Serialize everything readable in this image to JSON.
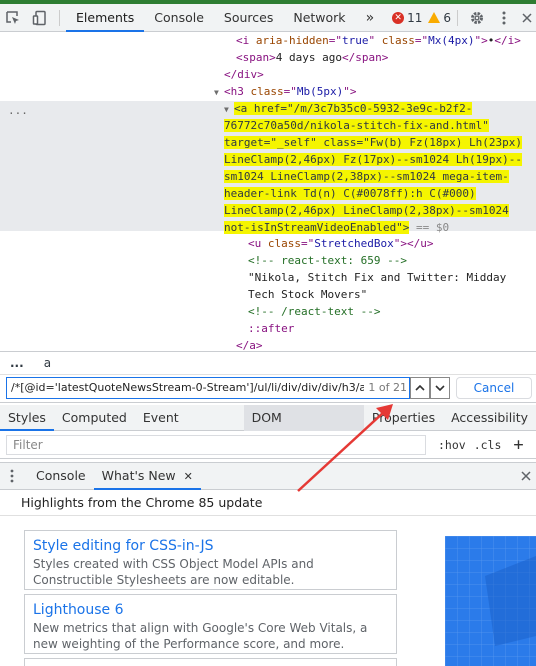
{
  "toolbar": {
    "tabs": [
      "Elements",
      "Console",
      "Sources",
      "Network"
    ],
    "more": "»",
    "errors": "11",
    "warnings": "6"
  },
  "dom": {
    "lines": [
      {
        "id": "l1",
        "text": "<i aria-hidden=\"true\" class=\"Mx(4px)\">•</i>"
      },
      {
        "id": "l2",
        "text": "<span>4 days ago</span>"
      },
      {
        "id": "l3",
        "text": "</div>"
      },
      {
        "id": "l4",
        "text": "<h3 class=\"Mb(5px)\">"
      },
      {
        "id": "l5",
        "text": "<a href=\"/m/3c7b35c0-5932-3e9c-b2f2-"
      },
      {
        "id": "l6",
        "text": "76772c70a50d/nikola-stitch-fix-and.html\""
      },
      {
        "id": "l7",
        "text": "target=\"_self\" class=\"Fw(b) Fz(18px) Lh(23px)"
      },
      {
        "id": "l8",
        "text": "LineClamp(2,46px) Fz(17px)--sm1024 Lh(19px)--"
      },
      {
        "id": "l9",
        "text": "sm1024 LineClamp(2,38px)--sm1024 mega-item-"
      },
      {
        "id": "l10",
        "text": "header-link Td(n) C(#0078ff):h C(#000)"
      },
      {
        "id": "l11",
        "text": "LineClamp(2,46px) LineClamp(2,38px)--sm1024"
      },
      {
        "id": "l12",
        "text": "not-isInStreamVideoEnabled\">"
      },
      {
        "id": "l12b",
        "text": " == $0"
      },
      {
        "id": "l13",
        "text": "<u class=\"StretchedBox\"></u>"
      },
      {
        "id": "l14",
        "text": "<!-- react-text: 659 -->"
      },
      {
        "id": "l15",
        "text": "\"Nikola, Stitch Fix and Twitter: Midday"
      },
      {
        "id": "l16",
        "text": "Tech Stock Movers\""
      },
      {
        "id": "l17",
        "text": "<!-- /react-text -->"
      },
      {
        "id": "l18",
        "text": "::after"
      },
      {
        "id": "l19",
        "text": "</a>"
      }
    ],
    "gutter": "..."
  },
  "breadcrumbs": [
    "...",
    "a"
  ],
  "search": {
    "value": "/*[@id='latestQuoteNewsStream-0-Stream']/ul/li/div/div/div/h3/a",
    "count": "1 of 21",
    "cancel": "Cancel"
  },
  "subtabs": [
    "Styles",
    "Computed",
    "Event Listeners",
    "DOM Breakpoints",
    "Properties",
    "Accessibility"
  ],
  "filter": {
    "placeholder": "Filter",
    "hov": ":hov",
    "cls": ".cls",
    "plus": "+"
  },
  "drawer": {
    "tabs": [
      "Console",
      "What's New"
    ],
    "close": "✕"
  },
  "whats_new": {
    "header": "Highlights from the Chrome 85 update",
    "cards": [
      {
        "title": "Style editing for CSS-in-JS",
        "desc": "Styles created with CSS Object Model APIs and Constructible Stylesheets are now editable."
      },
      {
        "title": "Lighthouse 6",
        "desc": "New metrics that align with Google's Core Web Vitals, a new weighting of the Performance score, and more."
      }
    ]
  },
  "colors": {
    "accent": "#1a73e8",
    "highlight": "#ffff33",
    "error": "#d93025",
    "warning": "#f9ab00",
    "annotation": "#e53935"
  }
}
